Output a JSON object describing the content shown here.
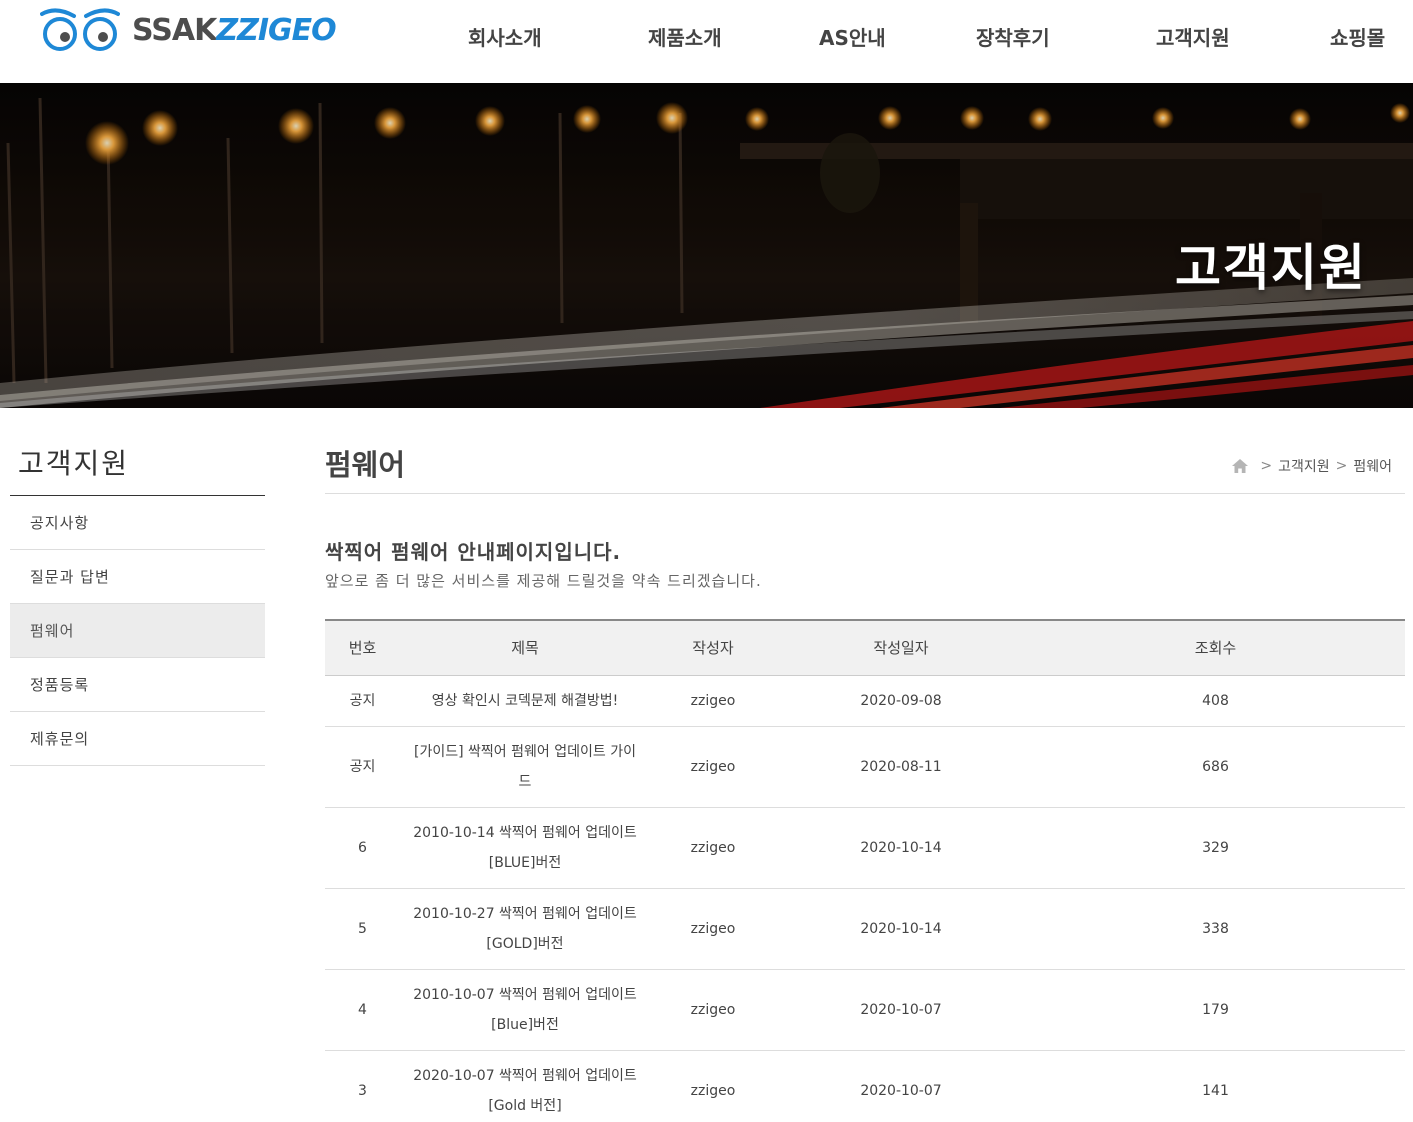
{
  "header": {
    "logo": {
      "part1": "SSAK",
      "part2": "ZZIGEO"
    },
    "nav": [
      {
        "label": "회사소개"
      },
      {
        "label": "제품소개"
      },
      {
        "label": "AS안내"
      },
      {
        "label": "장착후기"
      },
      {
        "label": "고객지원"
      },
      {
        "label": "쇼핑몰"
      }
    ]
  },
  "banner": {
    "title": "고객지원"
  },
  "sidebar": {
    "title": "고객지원",
    "items": [
      {
        "label": "공지사항",
        "active": false
      },
      {
        "label": "질문과 답변",
        "active": false
      },
      {
        "label": "펌웨어",
        "active": true
      },
      {
        "label": "정품등록",
        "active": false
      },
      {
        "label": "제휴문의",
        "active": false
      }
    ]
  },
  "main": {
    "title": "펌웨어",
    "breadcrumb": [
      "고객지원",
      "펌웨어"
    ],
    "intro_heading": "싹찍어 펌웨어 안내페이지입니다.",
    "intro_sub": "앞으로 좀 더 많은 서비스를 제공해 드릴것을 약속 드리겠습니다.",
    "table": {
      "headers": [
        "번호",
        "제목",
        "작성자",
        "작성일자",
        "조회수"
      ],
      "rows": [
        {
          "no": "공지",
          "title": "영상 확인시 코덱문제 해결방법!",
          "author": "zzigeo",
          "date": "2020-09-08",
          "views": "408"
        },
        {
          "no": "공지",
          "title": "[가이드] 싹찍어 펌웨어 업데이트 가이드",
          "author": "zzigeo",
          "date": "2020-08-11",
          "views": "686"
        },
        {
          "no": "6",
          "title": "2010-10-14 싹찍어 펌웨어 업데이트 [BLUE]버전",
          "author": "zzigeo",
          "date": "2020-10-14",
          "views": "329"
        },
        {
          "no": "5",
          "title": "2010-10-27 싹찍어 펌웨어 업데이트 [GOLD]버전",
          "author": "zzigeo",
          "date": "2020-10-14",
          "views": "338"
        },
        {
          "no": "4",
          "title": "2010-10-07 싹찍어 펌웨어 업데이트 [Blue]버전",
          "author": "zzigeo",
          "date": "2020-10-07",
          "views": "179"
        },
        {
          "no": "3",
          "title": "2020-10-07 싹찍어 펌웨어 업데이트 [Gold 버전]",
          "author": "zzigeo",
          "date": "2020-10-07",
          "views": "141"
        }
      ]
    }
  },
  "colors": {
    "brand_blue": "#1e88d6",
    "logo_gray": "#4d4d4d",
    "active_bg": "#ececec"
  }
}
